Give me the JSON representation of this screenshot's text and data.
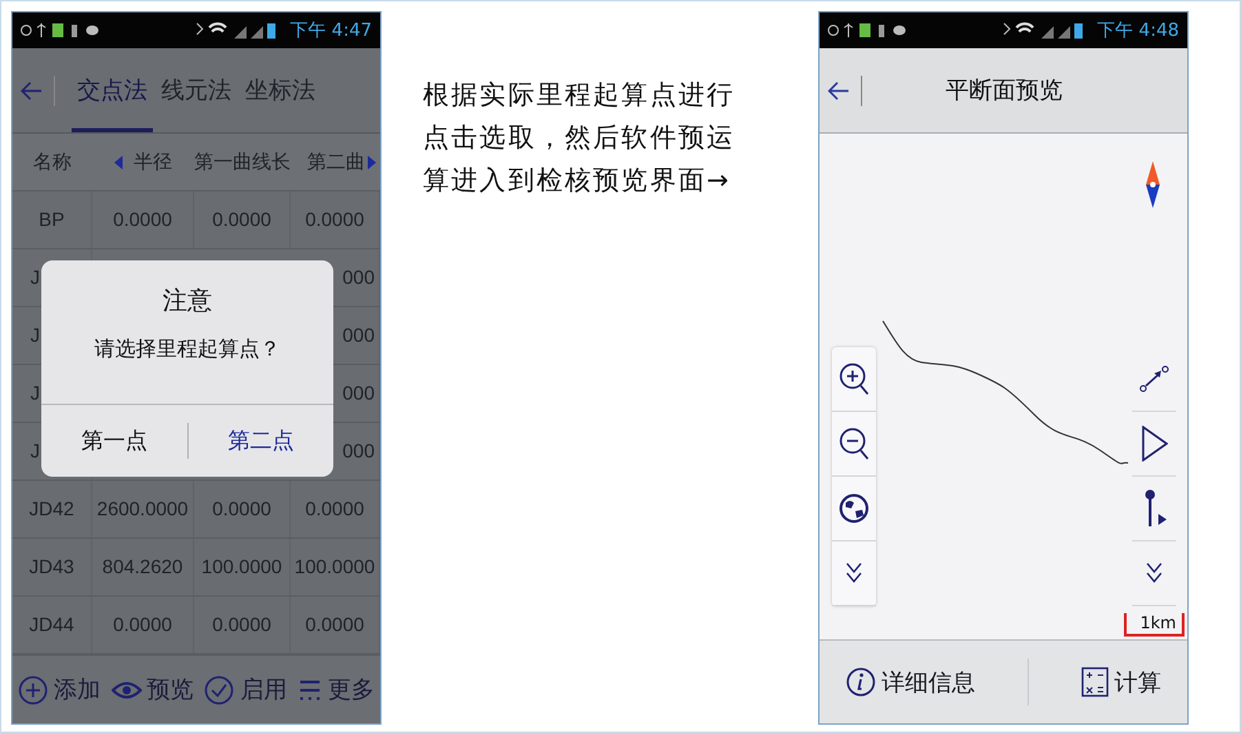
{
  "left_phone": {
    "status_bar": {
      "time": "下午 4:47"
    },
    "tabs": [
      {
        "label": "交点法",
        "selected": true
      },
      {
        "label": "线元法",
        "selected": false
      },
      {
        "label": "坐标法",
        "selected": false
      }
    ],
    "table": {
      "columns": [
        "名称",
        "半径",
        "第一曲线长",
        "第二曲"
      ],
      "rows": [
        {
          "kind": "full",
          "cells": [
            "BP",
            "0.0000",
            "0.0000",
            "0.0000"
          ]
        },
        {
          "kind": "covered",
          "cells": [
            "J",
            "000"
          ]
        },
        {
          "kind": "covered",
          "cells": [
            "J",
            "000"
          ]
        },
        {
          "kind": "covered",
          "cells": [
            "J",
            "000"
          ]
        },
        {
          "kind": "covered",
          "cells": [
            "J",
            "000"
          ]
        },
        {
          "kind": "full",
          "cells": [
            "JD42",
            "2600.0000",
            "0.0000",
            "0.0000"
          ]
        },
        {
          "kind": "full",
          "cells": [
            "JD43",
            "804.2620",
            "100.0000",
            "100.0000"
          ]
        },
        {
          "kind": "full",
          "cells": [
            "JD44",
            "0.0000",
            "0.0000",
            "0.0000"
          ]
        }
      ]
    },
    "dialog": {
      "title": "注意",
      "message": "请选择里程起算点？",
      "buttons": [
        {
          "label": "第一点",
          "selected": false
        },
        {
          "label": "第二点",
          "selected": true
        }
      ]
    },
    "toolbar": [
      "添加",
      "预览",
      "启用",
      "更多"
    ]
  },
  "caption": "根据实际里程起算点进行点击选取，然后软件预运算进入到检核预览界面→",
  "right_phone": {
    "status_bar": {
      "time": "下午 4:48"
    },
    "title": "平断面预览",
    "scale": "1km",
    "bottom_buttons": [
      "详细信息",
      "计算"
    ]
  }
}
